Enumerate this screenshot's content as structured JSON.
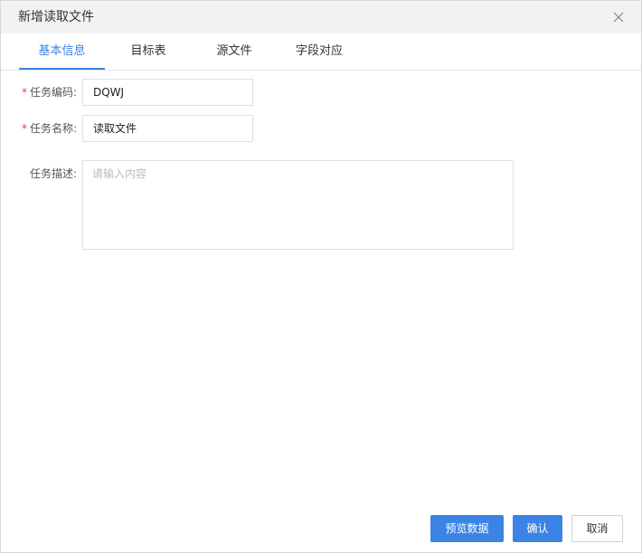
{
  "dialog": {
    "title": "新增读取文件",
    "close_icon": "close-icon"
  },
  "tabs": [
    {
      "label": "基本信息",
      "active": true
    },
    {
      "label": "目标表",
      "active": false
    },
    {
      "label": "源文件",
      "active": false
    },
    {
      "label": "字段对应",
      "active": false
    }
  ],
  "form": {
    "required_mark": "*",
    "task_code": {
      "label": "任务编码:",
      "value": "DQWJ"
    },
    "task_name": {
      "label": "任务名称:",
      "value": "读取文件"
    },
    "task_desc": {
      "label": "任务描述:",
      "value": "",
      "placeholder": "请输入内容"
    }
  },
  "footer": {
    "preview_label": "预览数据",
    "confirm_label": "确认",
    "cancel_label": "取消"
  },
  "colors": {
    "accent": "#3b84e6",
    "required": "#e04040",
    "header_bg": "#f2f2f5"
  }
}
